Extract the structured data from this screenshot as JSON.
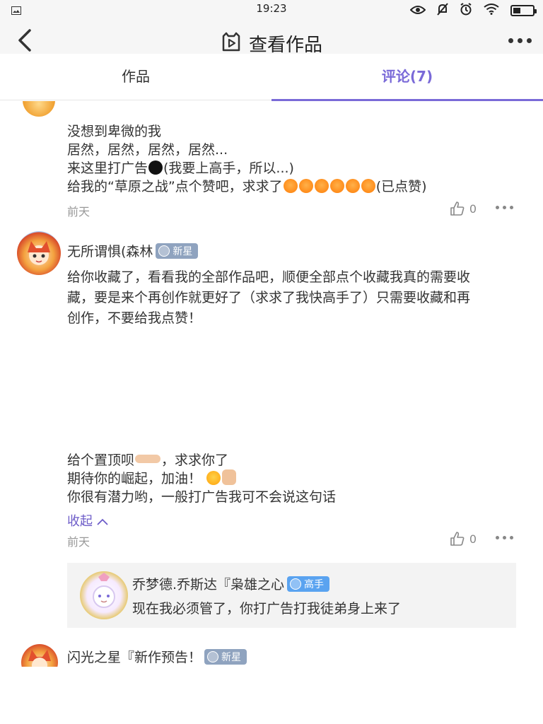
{
  "status_bar": {
    "time": "19:23"
  },
  "header": {
    "title": "查看作品"
  },
  "tabs": [
    {
      "label": "作品"
    },
    {
      "label": "评论(7)"
    }
  ],
  "comments": [
    {
      "lines": [
        "没想到卑微的我",
        "居然，居然，居然，居然...",
        "来这里打广告",
        "(我要上高手，所以...)",
        "给我的“草原之战”点个赞吧，求求了",
        "(已点赞)"
      ],
      "time": "前天",
      "likes": "0"
    },
    {
      "user": "无所谓惧(森林",
      "badge": "新星",
      "lines": [
        "给你收藏了，看看我的全部作品吧，顺便全部点个收藏我真的需要收",
        "藏，要是来个再创作就更好了（求求了我快高手了）只需要收藏和再",
        "创作，不要给我点赞！"
      ],
      "lines2": [
        "给个置顶呗",
        "，求求你了",
        "期待你的崛起，加油！",
        "你很有潜力哟，一般打广告我可不会说这句话"
      ],
      "collapse": "收起",
      "time": "前天",
      "likes": "0",
      "reply": {
        "user": "乔梦德.乔斯达『枭雄之心",
        "badge": "高手",
        "text": "现在我必须管了，你打广告打我徒弟身上来了"
      }
    },
    {
      "user": "闪光之星『新作预告！",
      "badge": "新星"
    }
  ],
  "colors": {
    "accent": "#7a6ad8",
    "badge_xinxing": "#8fa3bf",
    "badge_gaoshou": "#5aa3f0"
  }
}
